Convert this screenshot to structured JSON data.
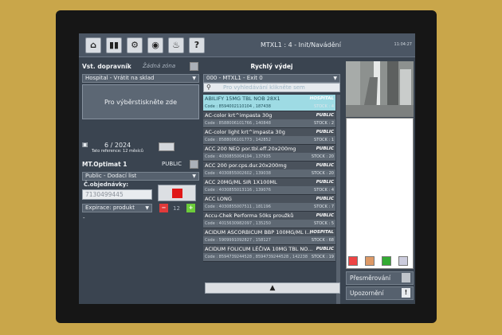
{
  "toolbar": {
    "home_icon": "home-icon",
    "buttons": [
      "home-icon",
      "panels-icon",
      "gear-icon",
      "eye-icon",
      "bulb-icon",
      "help-icon"
    ],
    "help_label": "?"
  },
  "window": {
    "title": "MTXL1 : 4 - Init/Navádění",
    "clock": "11:04:27"
  },
  "left": {
    "carrier_label": "Vst. dopravník",
    "zone_value": "Žádná zóna",
    "mode_select": "Hospital - Vrátit na sklad",
    "select_prompt": "Pro výběrstiskněte zde",
    "date_value": "6 / 2024",
    "date_reference": "Tato reference: 12 měsíců",
    "optimat_label": "MT.Optimat 1",
    "optimat_value": "PUBLIC",
    "doc_type": "Public - Dodací list",
    "order_label": "Č.objednávky:",
    "order_value": "7130499445",
    "expiry_select": "Expirace: produkt",
    "counter_value": "12",
    "minus_label": "−",
    "plus_label": "+",
    "dash": "-"
  },
  "middle": {
    "header": "Rychlý výdej",
    "exit_select": "000 - MTXL1 - Exit 0",
    "search_placeholder": "Pro vyhledávání klikněte sem",
    "up_label": "▲",
    "items": [
      {
        "name": "ABILIFY 15MG TBL NOB 28X1",
        "badge": "HOSPITAL",
        "code": "Code : 8594002110104 , 187438",
        "stock": "STOCK : 4",
        "selected": true
      },
      {
        "name": "AC-color krt^impasta 30g",
        "badge": "PUBLIC",
        "code": "Code : 8588006101766 , 140848",
        "stock": "STOCK : 2",
        "selected": false
      },
      {
        "name": "AC-color light krt^impasta 30g",
        "badge": "PUBLIC",
        "code": "Code : 8588006101773 , 142852",
        "stock": "STOCK : 1",
        "selected": false
      },
      {
        "name": "ACC 200 NEO por.tbl.eff.20x200mg",
        "badge": "PUBLIC",
        "code": "Code : 4030855004194 , 137935",
        "stock": "STOCK : 20",
        "selected": false
      },
      {
        "name": "ACC 200 por.cps.dur.20x200mg",
        "badge": "PUBLIC",
        "code": "Code : 4030855002602 , 139038",
        "stock": "STOCK : 20",
        "selected": false
      },
      {
        "name": "ACC 20MG/ML SIR 1X100ML",
        "badge": "PUBLIC",
        "code": "Code : 4030855013116 , 139076",
        "stock": "STOCK : 4",
        "selected": false
      },
      {
        "name": "ACC LONG",
        "badge": "PUBLIC",
        "code": "Code : 4030855007511 , 181196",
        "stock": "STOCK : 7",
        "selected": false
      },
      {
        "name": "Accu-Chek Performa 50ks proužků",
        "badge": "PUBLIC",
        "code": "Code : 4015630982097 , 135250",
        "stock": "STOCK : 5",
        "selected": false
      },
      {
        "name": "ACIDUM ASCORBICUM BBP 100MG/ML I...",
        "badge": "HOSPITAL",
        "code": "Code : 5909991092827 , 158127",
        "stock": "STOCK : 68",
        "selected": false
      },
      {
        "name": "ACIDUM FOLICUM LÉČIVA 10MG TBL NO...",
        "badge": "PUBLIC",
        "code": "Code : 8594739244528 , 8594739244528 , 142238",
        "stock": "STOCK : 19",
        "selected": false
      }
    ]
  },
  "right": {
    "redirect_label": "Přesměrování",
    "alerts_label": "Upozornění",
    "alert_icon": "!"
  },
  "colors": {
    "selected_row": "#9edbe4",
    "screen_bg": "#3a4450",
    "record_red": "#e01818",
    "plus_green": "#6ccc3a"
  }
}
